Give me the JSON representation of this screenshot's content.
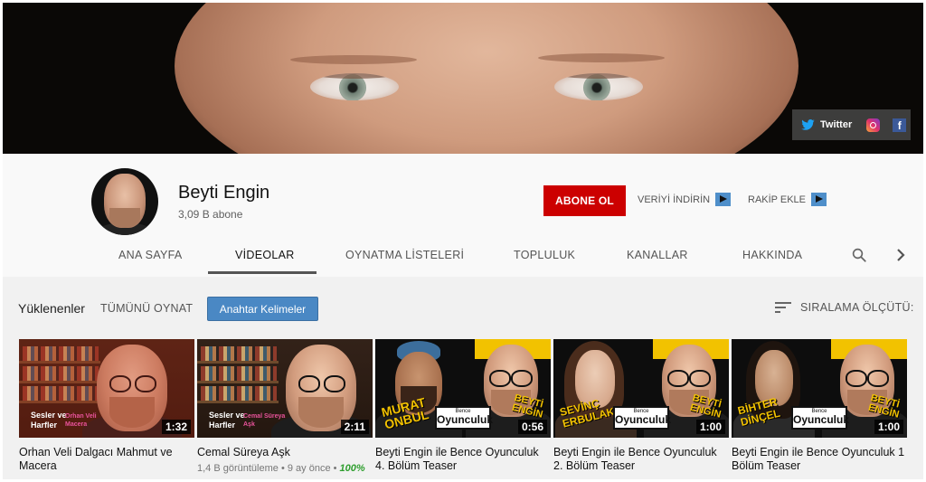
{
  "banner": {
    "social": {
      "twitter_label": "Twitter"
    }
  },
  "channel": {
    "name": "Beyti Engin",
    "subscribers": "3,09 B abone",
    "subscribe_label": "ABONE OL",
    "download_label": "VERİYİ İNDİRİN",
    "competitor_label": "RAKİP EKLE",
    "accent_color": "#cc0000"
  },
  "tabs": [
    {
      "label": "ANA SAYFA"
    },
    {
      "label": "VİDEOLAR",
      "active": true
    },
    {
      "label": "OYNATMA LİSTELERİ"
    },
    {
      "label": "TOPLULUK"
    },
    {
      "label": "KANALLAR"
    },
    {
      "label": "HAKKINDA"
    }
  ],
  "section": {
    "title": "Yüklenenler",
    "play_all": "TÜMÜNÜ OYNAT",
    "keywords_button": "Anahtar Kelimeler",
    "sort_label": "SIRALAMA ÖLÇÜTÜ:"
  },
  "videos": [
    {
      "title": "Orhan Veli Dalgacı Mahmut ve Macera",
      "duration": "1:32",
      "thumb_caption": [
        "Sesler ve",
        "Harfler"
      ],
      "thumb_subtitle": [
        "Orhan Veli",
        "Macera"
      ]
    },
    {
      "title": "Cemal Süreya Aşk",
      "duration": "2:11",
      "thumb_caption": [
        "Sesler ve",
        "Harfler"
      ],
      "thumb_subtitle": [
        "Cemal Süreya",
        "Aşk"
      ],
      "views": "1,4 B görüntüleme",
      "age": "9 ay önce",
      "rating": "100%"
    },
    {
      "title": "Beyti Engin ile Bence Oyunculuk 4. Bölüm Teaser",
      "duration": "0:56",
      "guest": [
        "MURAT",
        "ONBUL"
      ],
      "host": [
        "BEYTİ",
        "ENGİN"
      ],
      "badge_small": "Bence",
      "badge_big": "Oyunculuk"
    },
    {
      "title": "Beyti Engin ile Bence Oyunculuk 2. Bölüm Teaser",
      "duration": "1:00",
      "guest": [
        "SEVİNÇ",
        "ERBULAK"
      ],
      "host": [
        "BEYTİ",
        "ENGİN"
      ],
      "badge_small": "Bence",
      "badge_big": "Oyunculuk"
    },
    {
      "title": "Beyti Engin ile Bence Oyunculuk 1 Bölüm Teaser",
      "duration": "1:00",
      "guest": [
        "BİHTER",
        "DİNÇEL"
      ],
      "host": [
        "BEYTİ",
        "ENGİN"
      ],
      "badge_small": "Bence",
      "badge_big": "Oyunculuk"
    }
  ]
}
